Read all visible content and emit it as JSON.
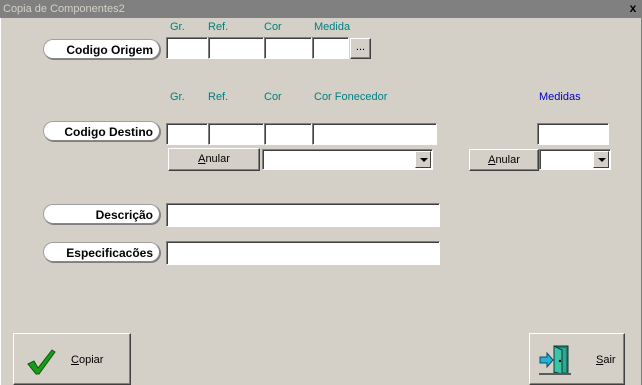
{
  "window": {
    "title": "Copia de Componentes2",
    "close_glyph": "x"
  },
  "origem": {
    "label": "Codigo Origem",
    "headers": [
      "Gr.",
      "Ref.",
      "Cor",
      "Medida"
    ],
    "values": [
      "",
      "",
      "",
      ""
    ],
    "ellipsis_label": "..."
  },
  "destino": {
    "label": "Codigo Destino",
    "headers": [
      "Gr.",
      "Ref.",
      "Cor",
      "Cor Fonecedor"
    ],
    "values": [
      "",
      "",
      "",
      ""
    ],
    "anular_label": "Anular",
    "anular_mnemonic": "A",
    "anular_rest": "nular",
    "combo_value": ""
  },
  "medidas": {
    "header": "Medidas",
    "value": "",
    "anular_mnemonic": "A",
    "anular_rest": "nular",
    "combo_value": ""
  },
  "descricao": {
    "label": "Descrição",
    "value": ""
  },
  "especificacoes": {
    "label": "Especificacões",
    "value": ""
  },
  "actions": {
    "copiar_mnemonic": "C",
    "copiar_rest": "opiar",
    "sair_mnemonic": "S",
    "sair_rest": "air"
  },
  "colors": {
    "header_teal": "#008080",
    "header_blue": "#0000c0",
    "check_green": "#1a9a1a"
  },
  "icons": {
    "copiar": "check-icon",
    "sair": "exit-door-icon"
  }
}
